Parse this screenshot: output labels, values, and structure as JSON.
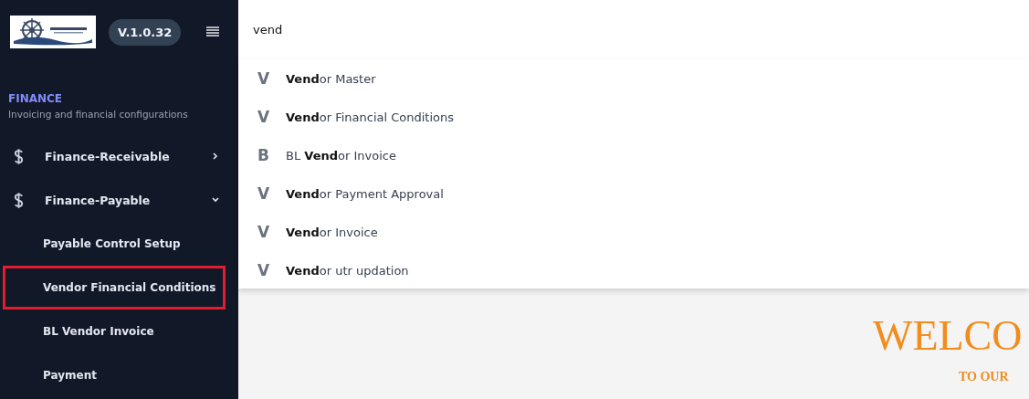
{
  "sidebar": {
    "version": "V.1.0.32",
    "section": {
      "title": "FINANCE",
      "subtitle": "Invoicing and financial configurations"
    },
    "items": [
      {
        "label": "Finance-Receivable",
        "expanded": false
      },
      {
        "label": "Finance-Payable",
        "expanded": true,
        "children": [
          {
            "label": "Payable Control Setup",
            "highlighted": false
          },
          {
            "label": "Vendor Financial Conditions",
            "highlighted": true
          },
          {
            "label": "BL Vendor Invoice",
            "highlighted": false
          },
          {
            "label": "Payment",
            "highlighted": false
          }
        ]
      }
    ]
  },
  "search": {
    "value": "vend"
  },
  "results": [
    {
      "letter": "V",
      "label": "**Vend**or Master"
    },
    {
      "letter": "V",
      "label": "**Vend**or Financial Conditions"
    },
    {
      "letter": "B",
      "label": "BL **Vend**or Invoice"
    },
    {
      "letter": "V",
      "label": "**Vend**or Payment Approval"
    },
    {
      "letter": "V",
      "label": "**Vend**or Invoice"
    },
    {
      "letter": "V",
      "label": "**Vend**or utr updation"
    }
  ],
  "welcome": {
    "title": "WELCO",
    "subtitle": "TO OUR"
  }
}
